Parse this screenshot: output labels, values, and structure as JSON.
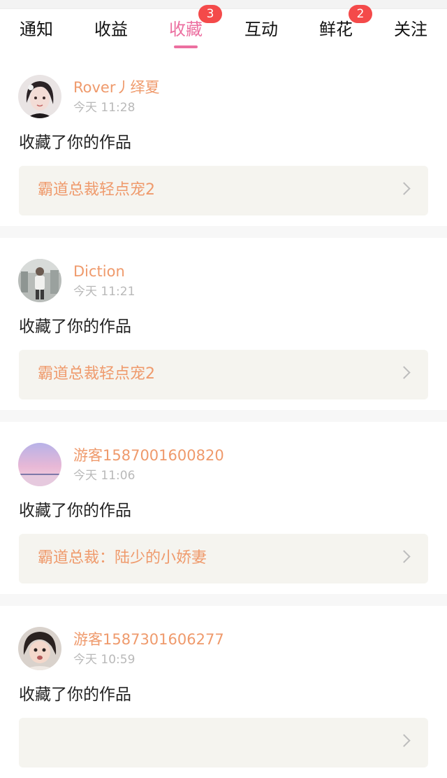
{
  "tabs": [
    {
      "label": "通知",
      "badge": null
    },
    {
      "label": "收益",
      "badge": null
    },
    {
      "label": "收藏",
      "badge": "3",
      "active": true
    },
    {
      "label": "互动",
      "badge": null
    },
    {
      "label": "鲜花",
      "badge": "2"
    },
    {
      "label": "关注",
      "badge": null
    }
  ],
  "colors": {
    "accent": "#ec6fa0",
    "name": "#ef9a6c",
    "badge": "#f44a4a"
  },
  "items": [
    {
      "user": "Rover丿绎夏",
      "time": "今天 11:28",
      "action": "收藏了你的作品",
      "work": "霸道总裁轻点宠2",
      "avatar": "avatar-girl-icon"
    },
    {
      "user": "Diction",
      "time": "今天 11:21",
      "action": "收藏了你的作品",
      "work": "霸道总裁轻点宠2",
      "avatar": "avatar-person-icon"
    },
    {
      "user": "游客1587001600820",
      "time": "今天 11:06",
      "action": "收藏了你的作品",
      "work": "霸道总裁：陆少的小娇妻",
      "avatar": "avatar-sunset-icon"
    },
    {
      "user": "游客1587301606277",
      "time": "今天 10:59",
      "action": "收藏了你的作品",
      "work": "",
      "avatar": "avatar-child-icon"
    }
  ]
}
